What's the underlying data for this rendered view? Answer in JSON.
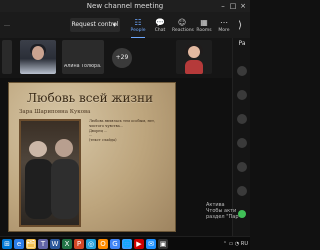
{
  "window": {
    "title": "New channel meeting",
    "minimize_icon": "–",
    "maximize_icon": "□",
    "close_icon": "×"
  },
  "topbar": {
    "left_label": "…",
    "request_control_label": "Request control",
    "tools": [
      {
        "label": "People",
        "icon": "☷"
      },
      {
        "label": "Chat",
        "icon": "💬"
      },
      {
        "label": "Reactions",
        "icon": "☺"
      },
      {
        "label": "Rooms",
        "icon": "▦"
      },
      {
        "label": "More",
        "icon": "⋯"
      }
    ],
    "side_toggle_icon": "⟩"
  },
  "strip": {
    "participant_name": "Алина Толюра...",
    "more_count": "+29"
  },
  "slide": {
    "title": "Любовь всей жизни",
    "subtitle": "Зара Шариповна Кукова",
    "body": "Любовь являлась тем особым, нет, \nчистого чувства...\nДворец ...\n...\n(текст слайда)"
  },
  "sidebar": {
    "tab_label": "Pa"
  },
  "activation": {
    "line1": "Актива",
    "line2": "Чтобы акти",
    "line3": "раздел \"Пар"
  },
  "taskbar": {
    "items": [
      {
        "icon": "⊞",
        "color": "#0078d4"
      },
      {
        "icon": "e",
        "color": "#2b7de9"
      },
      {
        "icon": "🗂",
        "color": "#f3c04f"
      },
      {
        "icon": "T",
        "color": "#6264a7"
      },
      {
        "icon": "W",
        "color": "#2b579a"
      },
      {
        "icon": "X",
        "color": "#217346"
      },
      {
        "icon": "P",
        "color": "#d24726"
      },
      {
        "icon": "◎",
        "color": "#25a0da"
      },
      {
        "icon": "O",
        "color": "#ff8c00"
      },
      {
        "icon": "G",
        "color": "#4285f4"
      },
      {
        "icon": "🌐",
        "color": "#3aa0ff"
      },
      {
        "icon": "▶",
        "color": "#cc0000"
      },
      {
        "icon": "✉",
        "color": "#1e90ff"
      },
      {
        "icon": "▣",
        "color": "#333333"
      }
    ],
    "tray_text": "⌃  ▭  ◔  RU"
  }
}
